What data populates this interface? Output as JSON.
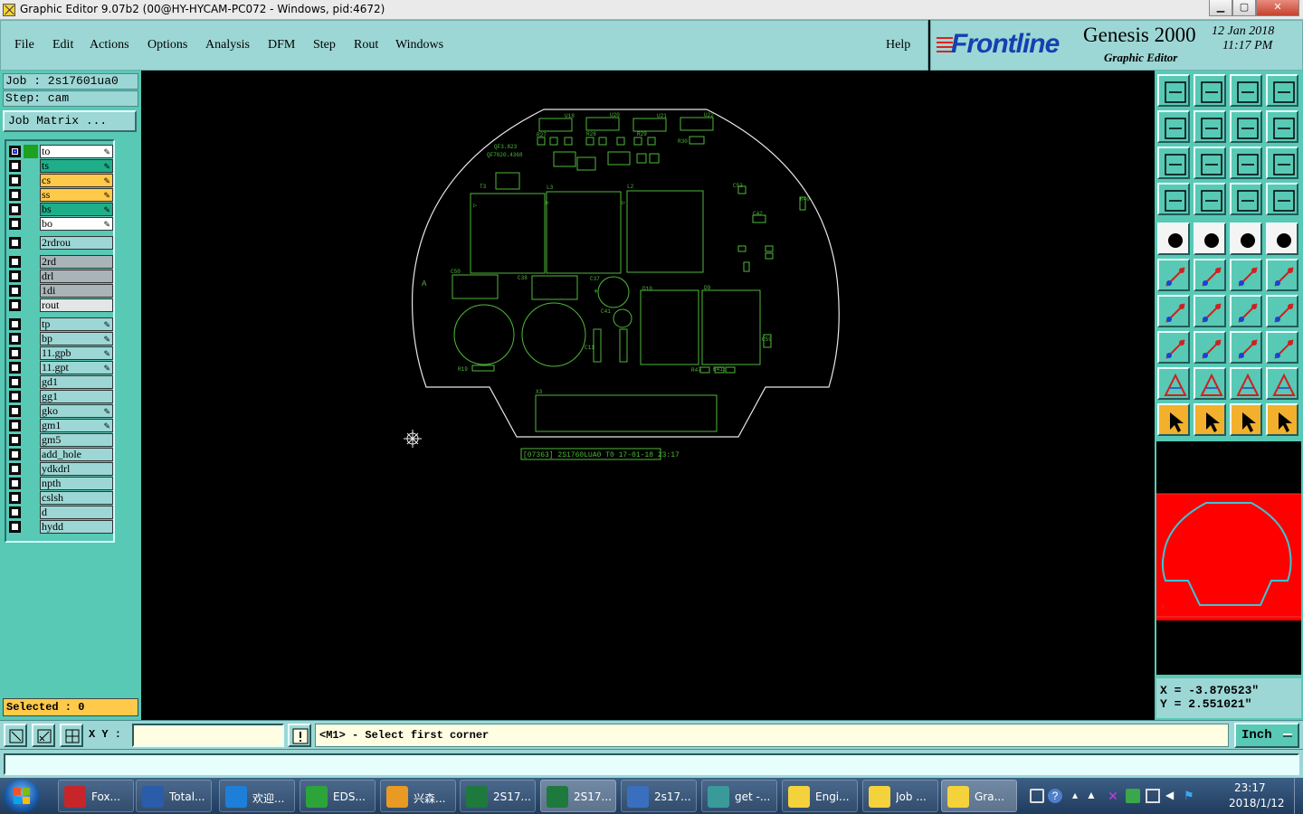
{
  "window": {
    "title": "Graphic Editor 9.07b2 (00@HY-HYCAM-PC072 - Windows, pid:4672)"
  },
  "menu": [
    "File",
    "Edit",
    "Actions",
    "Options",
    "Analysis",
    "DFM",
    "Step",
    "Rout",
    "Windows"
  ],
  "help_label": "Help",
  "brand": {
    "logo": "Frontline",
    "product": "Genesis 2000",
    "subtitle": "Graphic Editor",
    "date": "12 Jan 2018",
    "time": "11:17 PM"
  },
  "job": {
    "job_line": "Job : 2s17601ua0",
    "step_line": "Step: cam",
    "matrix_button": "Job Matrix ..."
  },
  "layers": [
    {
      "name": "to",
      "color": "#ffffff",
      "slot": "#20a020",
      "flag": "edit",
      "active": true
    },
    {
      "name": "ts",
      "color": "#1fae8a",
      "flag": "edit"
    },
    {
      "name": "cs",
      "color": "#ffc94a",
      "flag": "edit"
    },
    {
      "name": "ss",
      "color": "#ffc94a",
      "flag": "edit"
    },
    {
      "name": "bs",
      "color": "#1fae8a",
      "flag": "edit"
    },
    {
      "name": "bo",
      "color": "#ffffff",
      "flag": "edit"
    },
    {
      "name": "2rdrou",
      "color": "#9cd7d5"
    },
    {
      "name": "2rd",
      "color": "#a8b4b8"
    },
    {
      "name": "drl",
      "color": "#a8b4b8"
    },
    {
      "name": "1di",
      "color": "#a8b4b8"
    },
    {
      "name": "rout",
      "color": "#e2e6e6"
    },
    {
      "name": "tp",
      "color": "#9cd7d5",
      "flag": "edit"
    },
    {
      "name": "bp",
      "color": "#9cd7d5",
      "flag": "edit"
    },
    {
      "name": "11.gpb",
      "color": "#9cd7d5",
      "flag": "edit"
    },
    {
      "name": "11.gpt",
      "color": "#9cd7d5",
      "flag": "edit"
    },
    {
      "name": "gd1",
      "color": "#9cd7d5"
    },
    {
      "name": "gg1",
      "color": "#9cd7d5"
    },
    {
      "name": "gko",
      "color": "#9cd7d5",
      "flag": "edit"
    },
    {
      "name": "gm1",
      "color": "#9cd7d5",
      "flag": "edit"
    },
    {
      "name": "gm5",
      "color": "#9cd7d5"
    },
    {
      "name": "add_hole",
      "color": "#9cd7d5"
    },
    {
      "name": "ydkdrl",
      "color": "#9cd7d5"
    },
    {
      "name": "npth",
      "color": "#9cd7d5"
    },
    {
      "name": "cslsh",
      "color": "#9cd7d5"
    },
    {
      "name": "d",
      "color": "#9cd7d5"
    },
    {
      "name": "hydd",
      "color": "#9cd7d5"
    }
  ],
  "selected": "Selected : 0",
  "canvas": {
    "board_label": "[07363] 2S1760LUA0 T0 17-01-18 23:17",
    "refdes": [
      "U18",
      "U20",
      "U21",
      "U22",
      "QF3.823",
      "QF7820.4368",
      "R27",
      "R28",
      "R29",
      "R30",
      "T3",
      "L3",
      "L2",
      "C53",
      "R40",
      "C42",
      "C50",
      "C38",
      "C37",
      "C41",
      "C11",
      "D10",
      "D9",
      "R19",
      "R47",
      "R41",
      "X3"
    ]
  },
  "coords": {
    "x": "X = -3.870523\"",
    "y": "Y = 2.551021\""
  },
  "status": {
    "xy_label": "X Y :",
    "xy_value": "",
    "prompt": "<M1> - Select first corner",
    "unit": "Inch"
  },
  "taskbar": {
    "tasks": [
      {
        "label": "Fox...",
        "color": "#c8252a"
      },
      {
        "label": "Total...",
        "color": "#2a5caa"
      },
      {
        "label": "欢迎...",
        "color": "#1e7fd8"
      },
      {
        "label": "EDS...",
        "color": "#2ca43a"
      },
      {
        "label": "兴森...",
        "color": "#e89a24"
      },
      {
        "label": "2S17...",
        "color": "#1d7a3c"
      },
      {
        "label": "2S17...",
        "color": "#1d7a3c",
        "active": true
      },
      {
        "label": "2s17...",
        "color": "#3a6fc0"
      },
      {
        "label": "get -...",
        "color": "#3a9a9a"
      },
      {
        "label": "Engi...",
        "color": "#f4d23c"
      },
      {
        "label": "Job ...",
        "color": "#f4d23c"
      },
      {
        "label": "Gra...",
        "color": "#f4d23c",
        "active": true
      }
    ],
    "clock_time": "23:17",
    "clock_date": "2018/1/12"
  }
}
